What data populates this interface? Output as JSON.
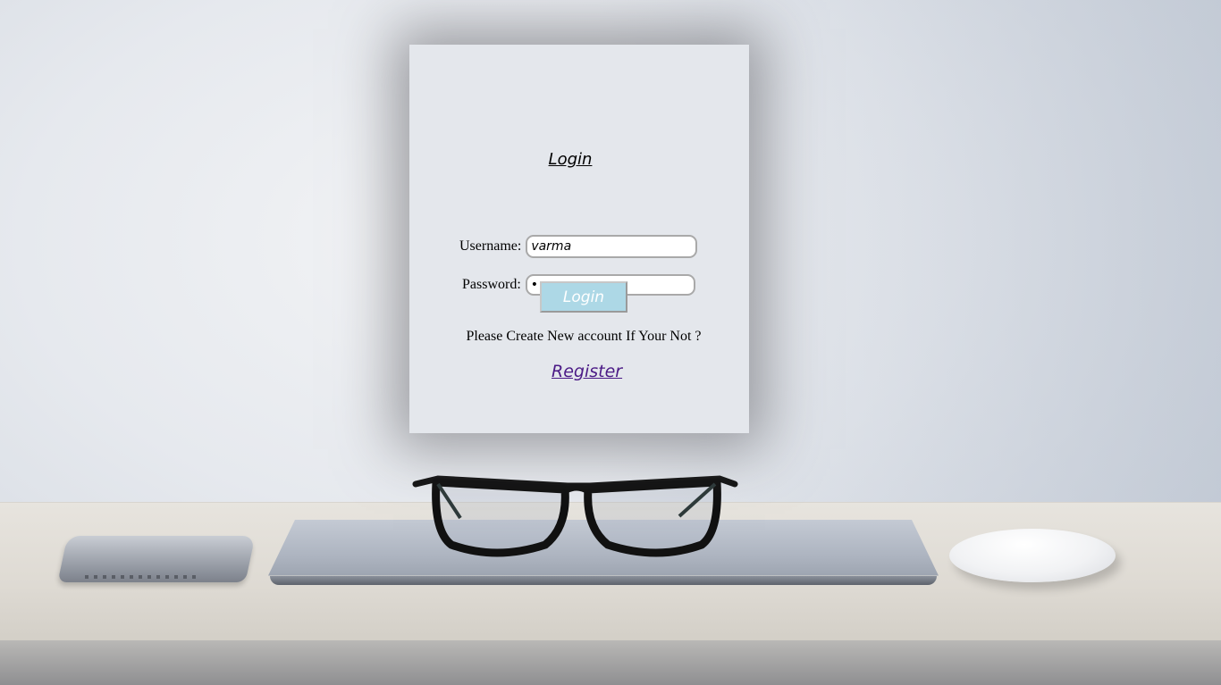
{
  "background": {
    "desc_icons": [
      "smartphone-icon",
      "laptop-icon",
      "eyeglasses-icon",
      "mouse-icon"
    ]
  },
  "login_card": {
    "title": "Login",
    "username": {
      "label": "Username:",
      "value": "varma"
    },
    "password": {
      "label": "Password:",
      "value": "12345678"
    },
    "login_button": "Login",
    "prompt": "Please Create New account If Your Not ?",
    "register_link": "Register"
  },
  "colors": {
    "card_background": "#e4e7ec",
    "login_button_background": "#add8e6",
    "register_link": "#4b1a86"
  }
}
